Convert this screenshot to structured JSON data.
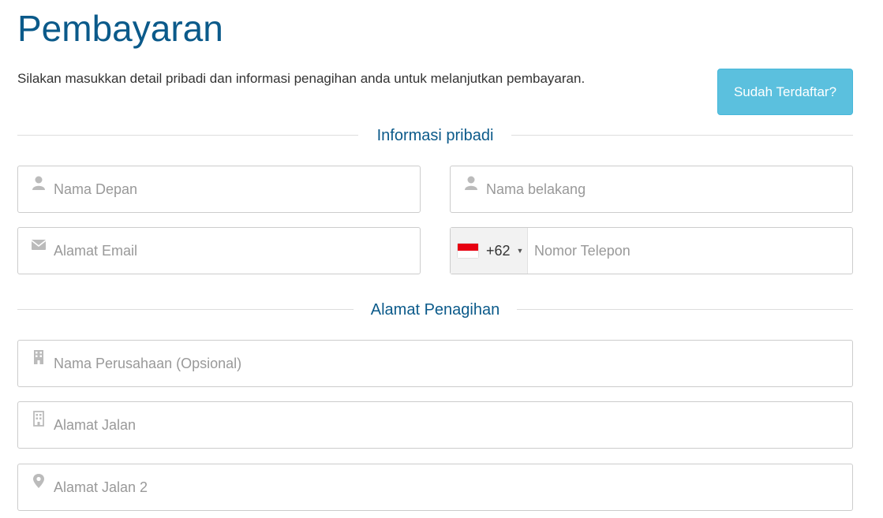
{
  "page": {
    "title": "Pembayaran",
    "intro": "Silakan masukkan detail pribadi dan informasi penagihan anda untuk melanjutkan pembayaran.",
    "login_button": "Sudah Terdaftar?"
  },
  "sections": {
    "personal": "Informasi pribadi",
    "billing": "Alamat Penagihan"
  },
  "fields": {
    "first_name": {
      "placeholder": "Nama Depan",
      "icon": "user-icon"
    },
    "last_name": {
      "placeholder": "Nama belakang",
      "icon": "user-icon"
    },
    "email": {
      "placeholder": "Alamat Email",
      "icon": "envelope-icon"
    },
    "phone": {
      "placeholder": "Nomor Telepon",
      "country_code": "+62",
      "flag": "indonesia-flag-icon"
    },
    "company": {
      "placeholder": "Nama Perusahaan (Opsional)",
      "icon": "building-icon"
    },
    "address1": {
      "placeholder": "Alamat Jalan",
      "icon": "building-icon"
    },
    "address2": {
      "placeholder": "Alamat Jalan 2",
      "icon": "map-marker-icon"
    }
  },
  "colors": {
    "title": "#0b5a8a",
    "button": "#5bc0de",
    "border": "#cccccc",
    "placeholder": "#999999",
    "icon": "#bbbbbb"
  }
}
